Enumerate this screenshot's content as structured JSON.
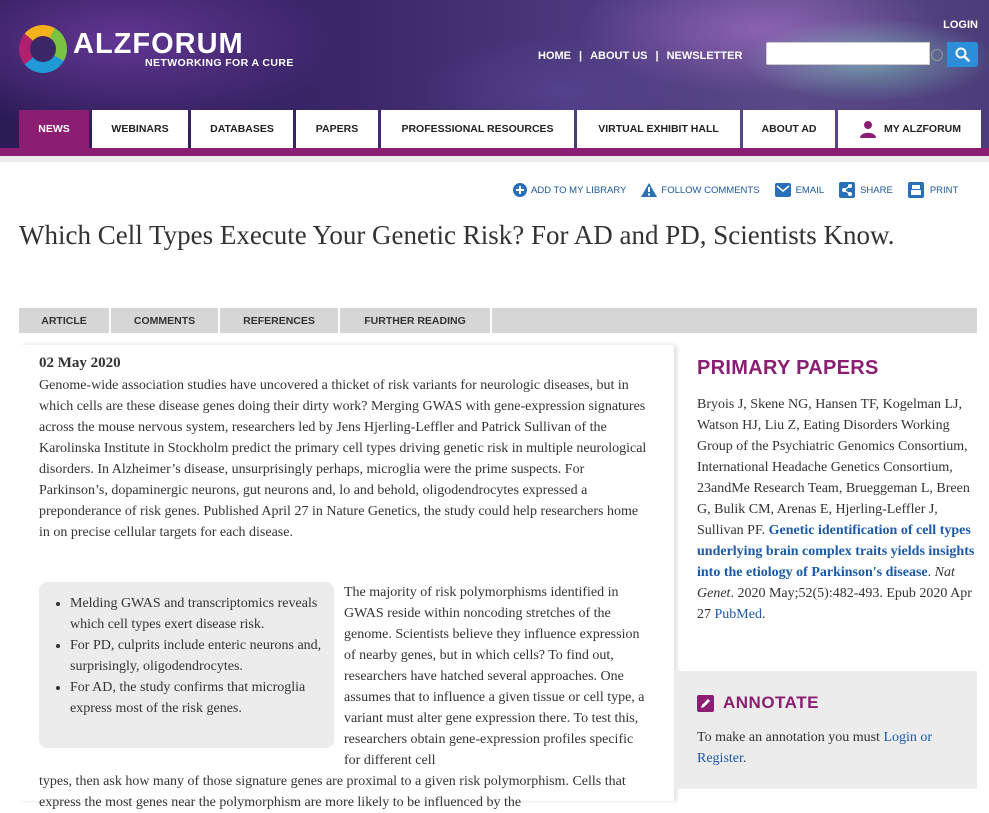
{
  "header": {
    "logo_name": "ALZFORUM",
    "logo_tagline": "NETWORKING FOR A CURE",
    "login": "LOGIN",
    "top_links": [
      "HOME",
      "ABOUT US",
      "NEWSLETTER"
    ],
    "search_placeholder": ""
  },
  "main_nav": [
    {
      "label": "NEWS",
      "active": true
    },
    {
      "label": "WEBINARS"
    },
    {
      "label": "DATABASES"
    },
    {
      "label": "PAPERS"
    },
    {
      "label": "PROFESSIONAL RESOURCES"
    },
    {
      "label": "VIRTUAL EXHIBIT HALL"
    },
    {
      "label": "ABOUT AD"
    },
    {
      "label": "MY ALZFORUM"
    }
  ],
  "tools": [
    {
      "label": "ADD TO MY LIBRARY",
      "icon": "plus-circle-icon"
    },
    {
      "label": "FOLLOW COMMENTS",
      "icon": "alert-icon"
    },
    {
      "label": "EMAIL",
      "icon": "email-icon"
    },
    {
      "label": "SHARE",
      "icon": "share-icon"
    },
    {
      "label": "PRINT",
      "icon": "print-icon"
    }
  ],
  "title": "Which Cell Types Execute Your Genetic Risk? For AD and PD, Scientists Know.",
  "article_tabs": [
    "ARTICLE",
    "COMMENTS",
    "REFERENCES",
    "FURTHER READING"
  ],
  "article": {
    "date": "02 May 2020",
    "intro": "Genome-wide association studies have uncovered a thicket of risk variants for neurologic diseases, but in which cells are these disease genes doing their dirty work? Merging GWAS with gene-expression signatures across the mouse nervous system, researchers led by Jens Hjerling-Leffler and Patrick Sullivan of the Karolinska Institute in Stockholm predict the primary cell types driving genetic risk in multiple neurological disorders. In Alzheimer’s disease, unsurprisingly perhaps, microglia were the prime suspects. For Parkinson’s, dopaminergic neurons, gut neurons and, lo and behold, oligodendrocytes expressed a preponderance of risk genes. Published April 27 in Nature Genetics, the study could help researchers home in on precise cellular targets for each disease.",
    "bullets": [
      "Melding GWAS and transcriptomics reveals which cell types exert disease risk.",
      "For PD, culprits include enteric neurons and, surprisingly, oligodendrocytes.",
      "For AD, the study confirms that microglia express most of the risk genes."
    ],
    "body_side": "The majority of risk polymorphisms identified in GWAS reside within noncoding stretches of the genome. Scientists believe they influence expression of nearby genes, but in which cells? To find out, researchers have hatched several approaches. One assumes that to influence a given tissue or cell type, a variant must alter gene expression there. To test this, researchers obtain gene-expression profiles specific for different cell",
    "body_full": "types, then ask how many of those signature genes are proximal to a given risk polymorphism. Cells that express the most genes near the polymorphism are more likely to be influenced by the"
  },
  "sidebar": {
    "primary_title": "PRIMARY PAPERS",
    "authors": "Bryois J, Skene NG, Hansen TF, Kogelman LJ, Watson HJ, Liu Z, Eating Disorders Working Group of the Psychiatric Genomics Consortium, International Headache Genetics Consortium, 23andMe Research Team, Brueggeman L, Breen G, Bulik CM, Arenas E, Hjerling-Leffler J, Sullivan PF.",
    "paper_title": "Genetic identification of cell types underlying brain complex traits yields insights into the etiology of Parkinson's disease",
    "journal": "Nat Genet",
    "citation_rest": ". 2020 May;52(5):482-493. Epub 2020 Apr 27",
    "pubmed": "PubMed",
    "annotate_title": "ANNOTATE",
    "annotate_text": "To make an annotation you must ",
    "annotate_link": "Login or Register"
  },
  "colors": {
    "brand_purple": "#8b1e72",
    "link_blue": "#1a5aa8",
    "search_button": "#2c8ed8"
  }
}
